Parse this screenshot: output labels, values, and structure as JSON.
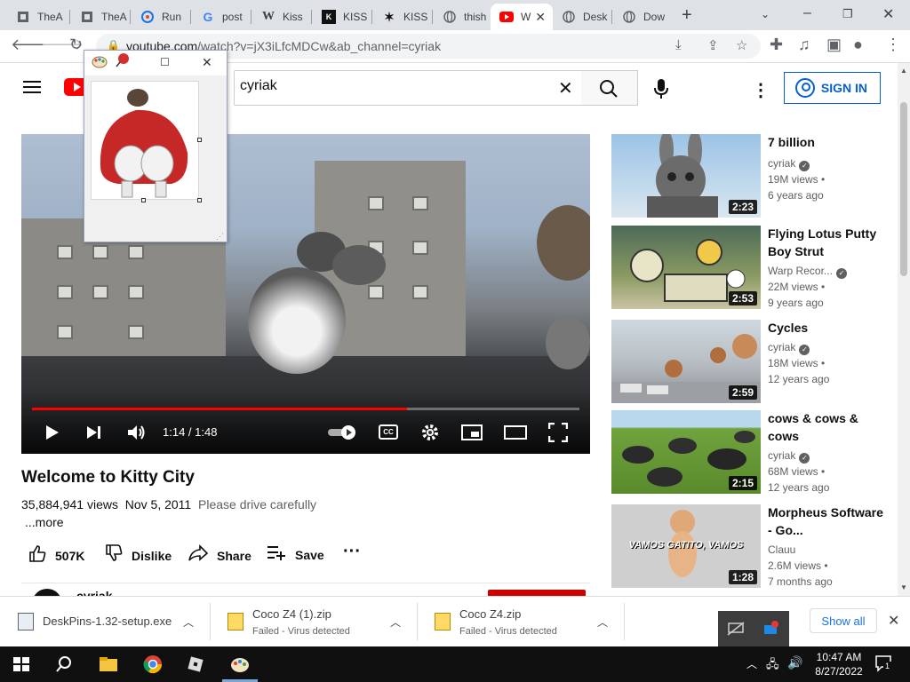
{
  "browser": {
    "tabs": [
      {
        "label": "TheA",
        "icon": "page-icon"
      },
      {
        "label": "TheA",
        "icon": "page-icon"
      },
      {
        "label": "Run",
        "icon": "run-icon"
      },
      {
        "label": "post",
        "icon": "google-icon"
      },
      {
        "label": "Kiss",
        "icon": "wikipedia-icon"
      },
      {
        "label": "KISS",
        "icon": "kiss-icon"
      },
      {
        "label": "KISS",
        "icon": "kiss-icon"
      },
      {
        "label": "thish",
        "icon": "globe-icon"
      },
      {
        "label": "W",
        "icon": "youtube-icon"
      },
      {
        "label": "Desk",
        "icon": "globe-icon"
      },
      {
        "label": "Dow",
        "icon": "globe-icon"
      }
    ],
    "active_tab_index": 8,
    "url_domain": "youtube.com",
    "url_path": "/watch?v=jX3iLfcMDCw&ab_channel=cyriak"
  },
  "youtube": {
    "search_value": "cyriak",
    "signin_label": "SIGN IN",
    "player": {
      "time": "1:14 / 1:48",
      "progress": 0.685
    },
    "video": {
      "title": "Welcome to Kitty City",
      "views": "35,884,941 views",
      "date": "Nov 5, 2011",
      "description": "Please drive carefully",
      "more": "...more",
      "likes": "507K",
      "dislike": "Dislike",
      "share": "Share",
      "save": "Save",
      "channel": "cyriak"
    },
    "related": [
      {
        "title": "7 billion",
        "channel": "cyriak",
        "views": "19M views",
        "age": "6 years ago",
        "duration": "2:23",
        "verified": true
      },
      {
        "title": "Flying Lotus Putty Boy Strut",
        "channel": "Warp Recor...",
        "views": "22M views",
        "age": "9 years ago",
        "duration": "2:53",
        "verified": true
      },
      {
        "title": "Cycles",
        "channel": "cyriak",
        "views": "18M views",
        "age": "12 years ago",
        "duration": "2:59",
        "verified": true
      },
      {
        "title": "cows & cows & cows",
        "channel": "cyriak",
        "views": "68M views",
        "age": "12 years ago",
        "duration": "2:15",
        "verified": true
      },
      {
        "title": "Morpheus Software - Go...",
        "channel": "Clauu",
        "views": "2.6M views",
        "age": "7 months ago",
        "duration": "1:28",
        "verified": false,
        "overlay": "VAMOS GATITO, VAMOS"
      }
    ]
  },
  "downloads": [
    {
      "name": "DeskPins-1.32-setup.exe",
      "status": ""
    },
    {
      "name": "Coco Z4 (1).zip",
      "status": "Failed - Virus detected"
    },
    {
      "name": "Coco Z4.zip",
      "status": "Failed - Virus detected"
    }
  ],
  "show_all": "Show all",
  "taskbar": {
    "time": "10:47 AM",
    "date": "8/27/2022",
    "notification_count": "1"
  },
  "colors": {
    "youtube_red": "#ff0000",
    "link_blue": "#065fd4",
    "chrome_tab_strip": "#dee1e6"
  }
}
